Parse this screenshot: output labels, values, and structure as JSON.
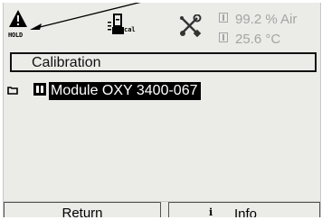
{
  "status_bar": {
    "hold_label": "HOLD",
    "hold_icon": "warning-triangle-icon",
    "calibration_icon": "sensor-calibration-icon",
    "calibration_sub_label": "cal",
    "service_icon": "wrench-screwdriver-icon",
    "readings": [
      {
        "channel_icon": "sensor-channel-icon",
        "value": "99.2 % Air"
      },
      {
        "channel_icon": "sensor-channel-icon",
        "value": "25.6 °C"
      }
    ]
  },
  "menu": {
    "title": "Calibration",
    "items": [
      {
        "folder_icon": "folder-icon",
        "module_icon": "module-slot-icon",
        "label": "Module OXY 3400-067",
        "selected": true
      }
    ]
  },
  "softkeys": {
    "left_label": "Return",
    "right_icon": "i",
    "right_label": "Info"
  },
  "colors": {
    "background": "#ebebe8",
    "text": "#111111",
    "reading_grey": "#a4a4a4",
    "selection_bg": "#000000",
    "selection_fg": "#ffffff"
  }
}
